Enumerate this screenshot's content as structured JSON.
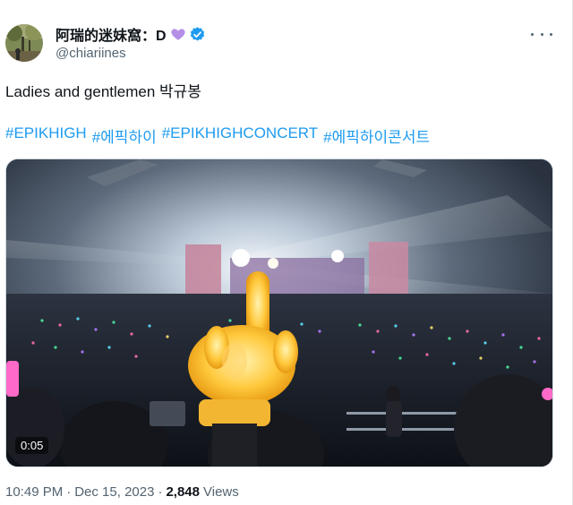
{
  "author": {
    "display_name": "阿瑞的迷妹窩：D",
    "handle": "@chiariines",
    "heart_emoji": "purple-heart-icon",
    "verified": "verified-badge-icon"
  },
  "tweet": {
    "text": "Ladies and gentlemen  박규봉",
    "hashtags": [
      "#EPIKHIGH",
      "#에픽하이",
      "#EPIKHIGHCONCERT",
      "#에픽하이콘서트"
    ]
  },
  "media": {
    "type": "video",
    "elapsed": "0:05"
  },
  "meta": {
    "time": "10:49 PM",
    "date": "Dec 15, 2023",
    "separator": "·",
    "views_count": "2,848",
    "views_label": "Views"
  },
  "colors": {
    "link": "#1d9bf0",
    "secondary_text": "#536471",
    "verified": "#1d9bf0",
    "heart": "#b58ee6"
  }
}
